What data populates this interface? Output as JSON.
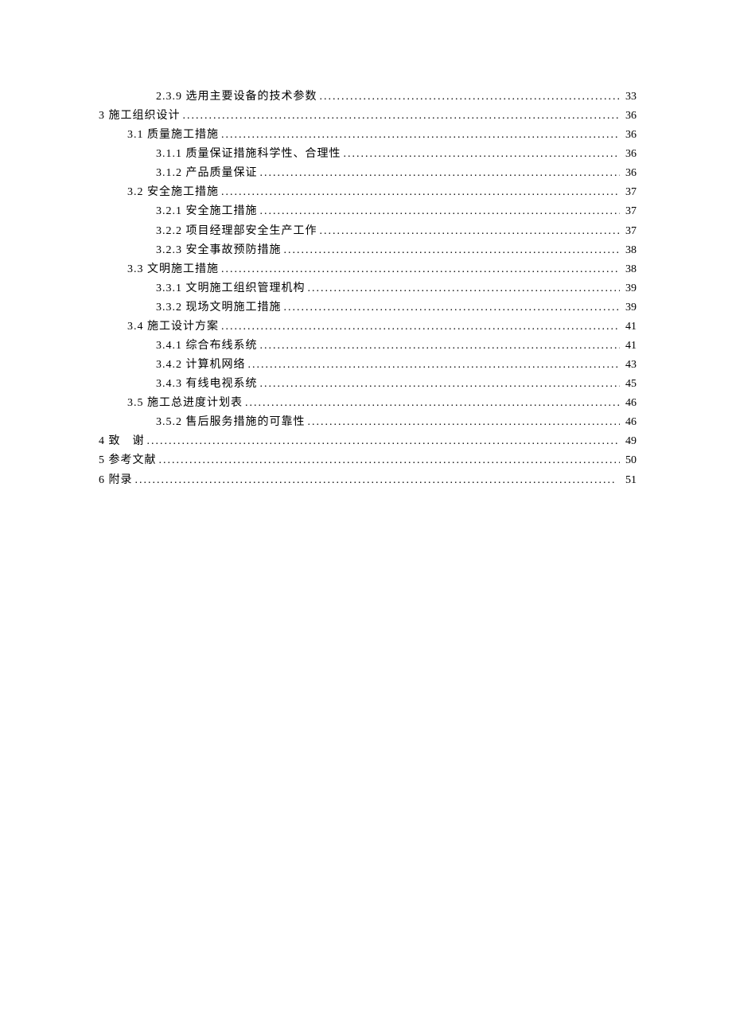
{
  "toc": [
    {
      "level": 2,
      "label": "2.3.9 选用主要设备的技术参数",
      "page": "33"
    },
    {
      "level": 0,
      "label": "3 施工组织设计",
      "page": "36"
    },
    {
      "level": 1,
      "label": "3.1 质量施工措施",
      "page": "36"
    },
    {
      "level": 2,
      "label": "3.1.1 质量保证措施科学性、合理性",
      "page": "36"
    },
    {
      "level": 2,
      "label": "3.1.2 产品质量保证",
      "page": "36"
    },
    {
      "level": 1,
      "label": "3.2 安全施工措施",
      "page": "37"
    },
    {
      "level": 2,
      "label": "3.2.1 安全施工措施",
      "page": "37"
    },
    {
      "level": 2,
      "label": "3.2.2 项目经理部安全生产工作",
      "page": "37"
    },
    {
      "level": 2,
      "label": "3.2.3 安全事故预防措施",
      "page": "38"
    },
    {
      "level": 1,
      "label": "3.3 文明施工措施",
      "page": "38"
    },
    {
      "level": 2,
      "label": "3.3.1 文明施工组织管理机构",
      "page": "39"
    },
    {
      "level": 2,
      "label": "3.3.2 现场文明施工措施",
      "page": "39"
    },
    {
      "level": 1,
      "label": "3.4 施工设计方案",
      "page": "41"
    },
    {
      "level": 2,
      "label": "3.4.1 综合布线系统",
      "page": "41"
    },
    {
      "level": 2,
      "label": "3.4.2 计算机网络",
      "page": "43"
    },
    {
      "level": 2,
      "label": "3.4.3 有线电视系统",
      "page": "45"
    },
    {
      "level": 1,
      "label": "3.5 施工总进度计划表",
      "page": "46"
    },
    {
      "level": 2,
      "label": "3.5.2 售后服务措施的可靠性",
      "page": "46"
    },
    {
      "level": 0,
      "label": "4 致　谢",
      "page": "49"
    },
    {
      "level": 0,
      "label": "5 参考文献",
      "page": "50"
    },
    {
      "level": 0,
      "label": "6 附录",
      "page": "51"
    }
  ]
}
